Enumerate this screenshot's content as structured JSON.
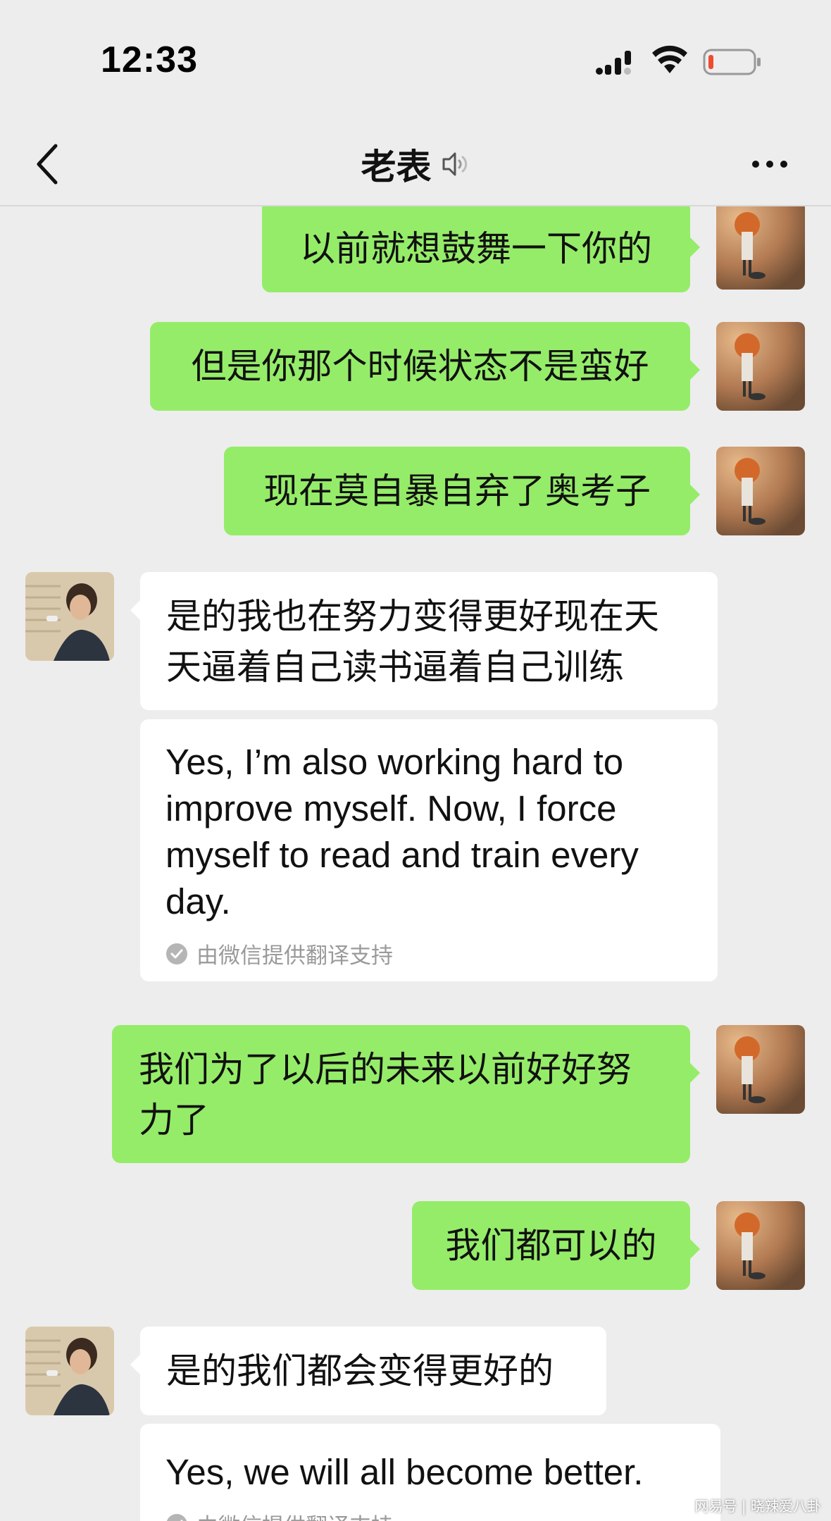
{
  "status_bar": {
    "time": "12:33"
  },
  "nav": {
    "title": "老表"
  },
  "messages": [
    {
      "direction": "outgoing",
      "text": "以前就想鼓舞一下你的"
    },
    {
      "direction": "outgoing",
      "text": "但是你那个时候状态不是蛮好"
    },
    {
      "direction": "outgoing",
      "text": "现在莫自暴自弃了奥考子"
    },
    {
      "direction": "incoming",
      "text_lines": [
        "是的我也在努力变得更好现在天",
        "天逼着自己读书逼着自己训练"
      ],
      "translation": "Yes, I’m also working hard to improve myself. Now, I force myself to read and train every day.",
      "translation_note": "由微信提供翻译支持"
    },
    {
      "direction": "outgoing",
      "text_lines": [
        "我们为了以后的未来以前好好努",
        "力了"
      ]
    },
    {
      "direction": "outgoing",
      "text": "我们都可以的"
    },
    {
      "direction": "incoming",
      "text": "是的我们都会变得更好的",
      "translation": "Yes, we will all become better.",
      "translation_note": "由微信提供翻译支持"
    }
  ],
  "watermark": "网易号 | 晓辣爱八卦",
  "colors": {
    "background": "#ededed",
    "outgoing_bubble": "#95ec69",
    "incoming_bubble": "#ffffff",
    "battery_low": "#f04a2f"
  },
  "icons": {
    "back": "chevron-left-icon",
    "mute": "speaker-icon",
    "more": "ellipsis-icon",
    "verified": "check-circle-icon"
  }
}
